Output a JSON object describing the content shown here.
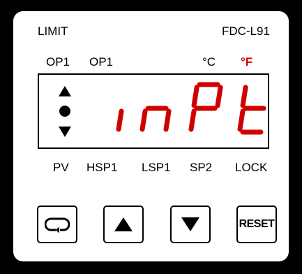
{
  "header": {
    "left_label": "LIMIT",
    "right_label": "FDC-L91"
  },
  "indicators": {
    "op1_a": "OP1",
    "op1_b": "OP1",
    "unit_c": "°C",
    "unit_f": "°F"
  },
  "display": {
    "text": "inPt",
    "segment_color": "#d10000",
    "annunciators": [
      "up-arrow-icon",
      "dot-icon",
      "down-arrow-icon"
    ]
  },
  "key_labels": [
    "PV",
    "HSP1",
    "LSP1",
    "SP2",
    "LOCK"
  ],
  "buttons": {
    "cycle_icon": "cycle-icon",
    "up_icon": "up-arrow-icon",
    "down_icon": "down-arrow-icon",
    "reset_label": "RESET"
  }
}
